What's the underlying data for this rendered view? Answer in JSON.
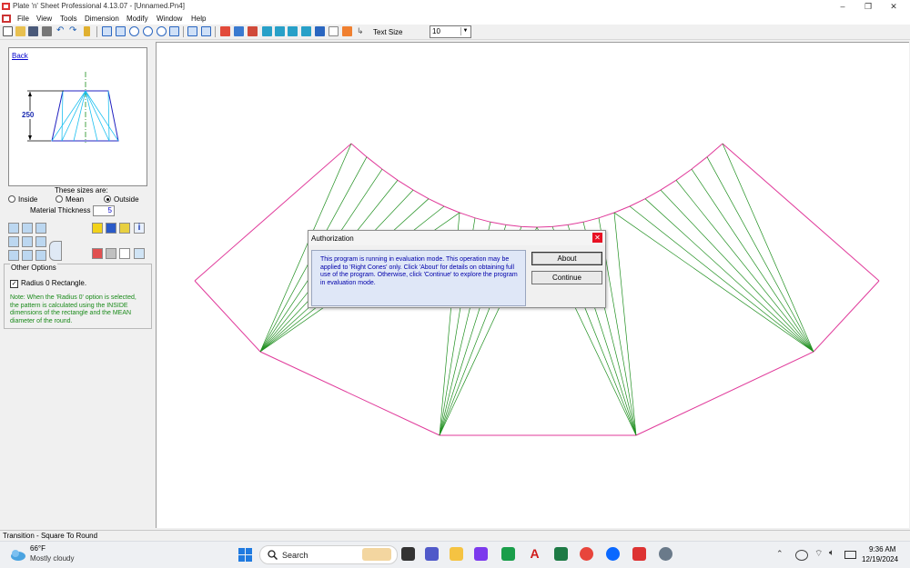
{
  "window": {
    "title": "Plate 'n' Sheet Professional 4.13.07  - [Unnamed.Pn4]",
    "controls": [
      "–",
      "❐",
      "✕"
    ]
  },
  "menu": [
    "File",
    "View",
    "Tools",
    "Dimension",
    "Modify",
    "Window",
    "Help"
  ],
  "toolbar": {
    "text_size_label": "Text Size",
    "text_size_value": "10"
  },
  "left_panel": {
    "back_label": "Back",
    "dimension_value": "250",
    "sizes_heading": "These sizes are:",
    "size_options": [
      {
        "label": "Inside",
        "selected": false
      },
      {
        "label": "Mean",
        "selected": false
      },
      {
        "label": "Outside",
        "selected": true
      }
    ],
    "thickness_label": "Material Thickness",
    "thickness_value": "5",
    "options_title": "Other Options",
    "radius_checkbox_label": "Radius 0 Rectangle.",
    "radius_checked": true,
    "note": "Note:  When the 'Radius 0' option is selected, the pattern is calculated using the INSIDE dimensions of the rectangle and the MEAN diameter of the round."
  },
  "dialog": {
    "title": "Authorization",
    "close": "✕",
    "message": "This program is running in evaluation mode.  This operation may be applied to 'Right Cones' only.  Click 'About' for details on obtaining full use of the program.  Otherwise, click 'Continue' to explore the program in evaluation mode.",
    "about_button": "About",
    "continue_button": "Continue"
  },
  "status": {
    "text": "Transition - Square To Round"
  },
  "taskbar": {
    "weather_temp": "66°F",
    "weather_desc": "Mostly cloudy",
    "search_placeholder": "Search",
    "time": "9:36 AM",
    "date": "12/19/2024"
  },
  "colors": {
    "pattern_outline": "#e0399a",
    "fold_lines": "#1f8f1f",
    "dialog_text": "#0000aa",
    "note_text": "#1a8a1a"
  }
}
